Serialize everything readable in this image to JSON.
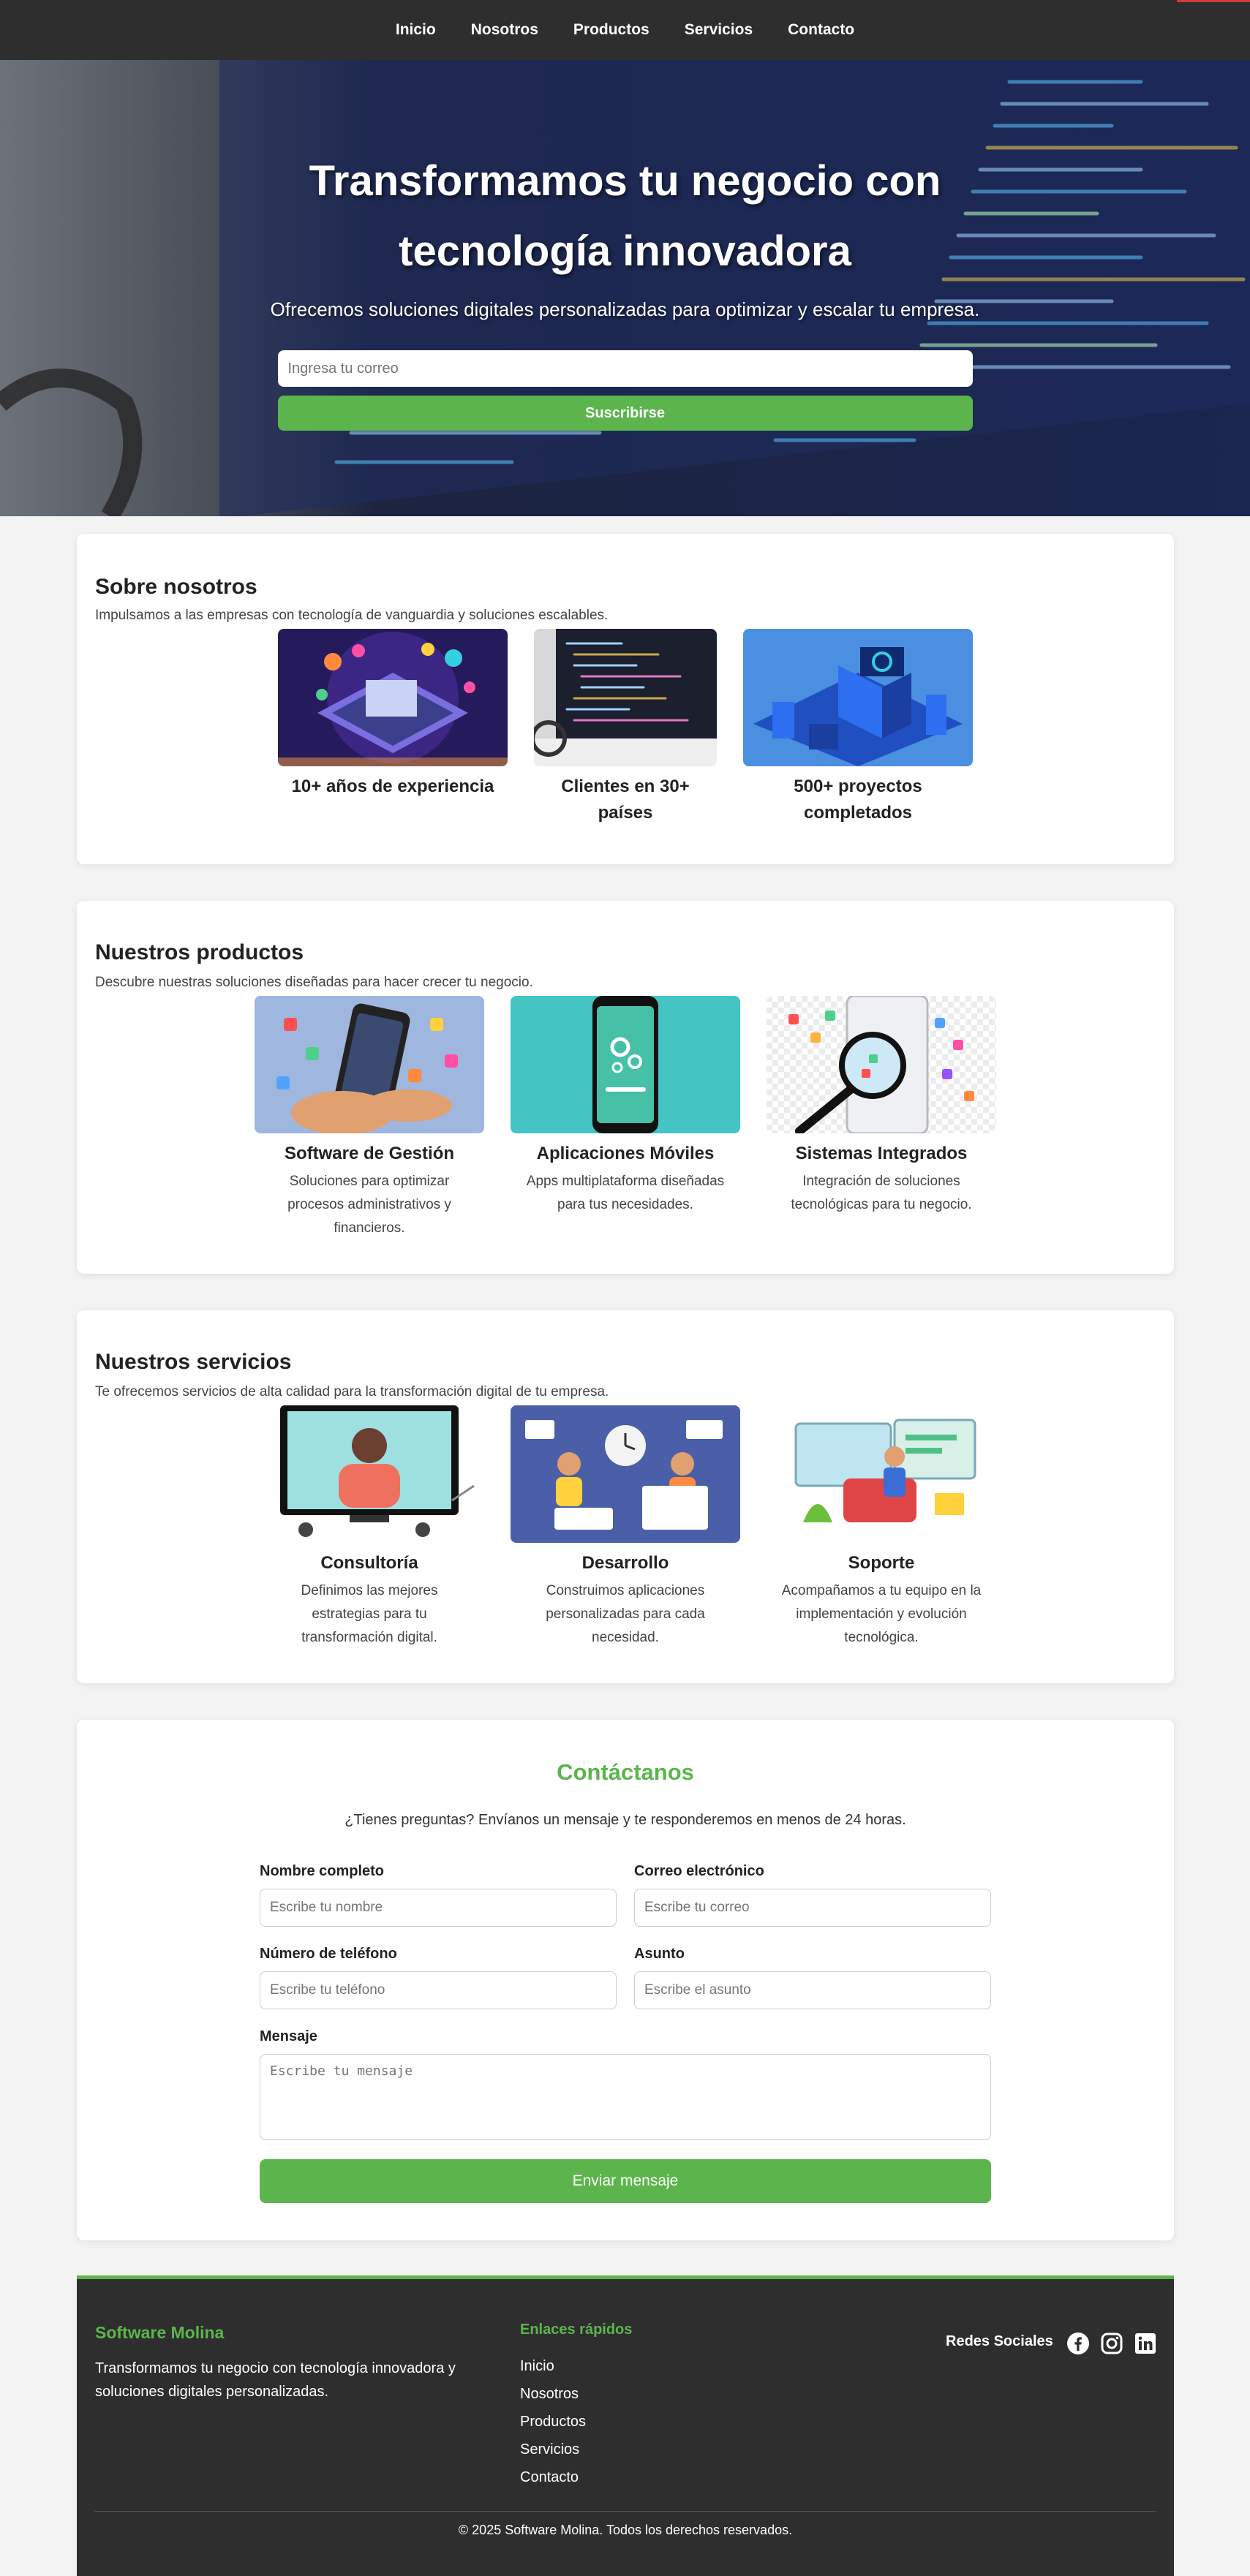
{
  "nav": {
    "items": [
      "Inicio",
      "Nosotros",
      "Productos",
      "Servicios",
      "Contacto"
    ]
  },
  "hero": {
    "title": "Transformamos tu negocio con tecnología innovadora",
    "subtitle": "Ofrecemos soluciones digitales personalizadas para optimizar y escalar tu empresa.",
    "email_placeholder": "Ingresa tu correo",
    "subscribe_label": "Suscribirse"
  },
  "about": {
    "title": "Sobre nosotros",
    "subtitle": "Impulsamos a las empresas con tecnología de vanguardia y soluciones escalables.",
    "items": [
      {
        "title": "10+ años de experiencia",
        "image": "isometric-tech-illustration"
      },
      {
        "title": "Clientes en 30+ países",
        "image": "code-monitor-photo"
      },
      {
        "title": "500+ proyectos completados",
        "image": "isometric-city-illustration"
      }
    ]
  },
  "products": {
    "title": "Nuestros productos",
    "subtitle": "Descubre nuestras soluciones diseñadas para hacer crecer tu negocio.",
    "items": [
      {
        "title": "Software de Gestión",
        "desc": "Soluciones para optimizar procesos administrativos y financieros.",
        "image": "phone-apps-illustration"
      },
      {
        "title": "Aplicaciones Móviles",
        "desc": "Apps multiplataforma diseñadas para tus necesidades.",
        "image": "phone-gears-illustration"
      },
      {
        "title": "Sistemas Integrados",
        "desc": "Integración de soluciones tecnológicas para tu negocio.",
        "image": "magnifier-apps-illustration"
      }
    ]
  },
  "services": {
    "title": "Nuestros servicios",
    "subtitle": "Te ofrecemos servicios de alta calidad para la transformación digital de tu empresa.",
    "items": [
      {
        "title": "Consultoría",
        "desc": "Definimos las mejores estrategias para tu transformación digital.",
        "image": "consulting-illustration"
      },
      {
        "title": "Desarrollo",
        "desc": "Construimos aplicaciones personalizadas para cada necesidad.",
        "image": "development-team-illustration"
      },
      {
        "title": "Soporte",
        "desc": "Acompañamos a tu equipo en la implementación y evolución tecnológica.",
        "image": "support-illustration"
      }
    ]
  },
  "contact": {
    "title": "Contáctanos",
    "intro": "¿Tienes preguntas? Envíanos un mensaje y te responderemos en menos de 24 horas.",
    "fields": {
      "name": {
        "label": "Nombre completo",
        "placeholder": "Escribe tu nombre"
      },
      "email": {
        "label": "Correo electrónico",
        "placeholder": "Escribe tu correo"
      },
      "phone": {
        "label": "Número de teléfono",
        "placeholder": "Escribe tu teléfono"
      },
      "subject": {
        "label": "Asunto",
        "placeholder": "Escribe el asunto"
      },
      "message": {
        "label": "Mensaje",
        "placeholder": "Escribe tu mensaje"
      }
    },
    "submit_label": "Enviar mensaje"
  },
  "footer": {
    "brand": "Software Molina",
    "brand_desc": "Transformamos tu negocio con tecnología innovadora y soluciones digitales personalizadas.",
    "links_title": "Enlaces rápidos",
    "links": [
      "Inicio",
      "Nosotros",
      "Productos",
      "Servicios",
      "Contacto"
    ],
    "social_title": "Redes Sociales",
    "socials": [
      "facebook-icon",
      "instagram-icon",
      "linkedin-icon"
    ],
    "copyright": "© 2025 Software Molina. Todos los derechos reservados."
  },
  "colors": {
    "accent": "#5cb54c",
    "dark": "#2e2e2e"
  }
}
